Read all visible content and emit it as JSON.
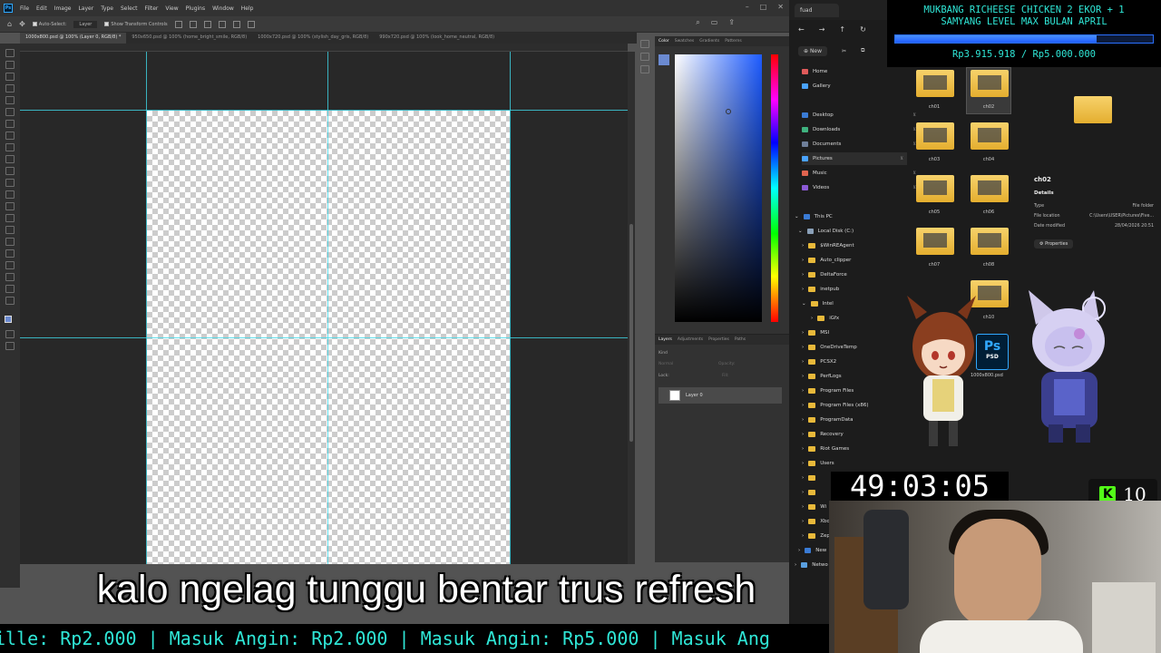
{
  "photoshop": {
    "logo": "Ps",
    "menu": [
      "File",
      "Edit",
      "Image",
      "Layer",
      "Type",
      "Select",
      "Filter",
      "View",
      "Plugins",
      "Window",
      "Help"
    ],
    "options": {
      "auto_select": "Auto-Select:",
      "auto_select_value": "Layer",
      "transform_controls": "Show Transform Controls"
    },
    "doc_tabs": [
      "1000x800.psd @ 100% (Layer 0, RGB/8) *",
      "950x650.psd @ 100% (home_bright_smile, RGB/8)",
      "1000x720.psd @ 100% (stylish_day_gris, RGB/8)",
      "990x720.psd @ 100% (look_home_neutral, RGB/8)"
    ],
    "color_panel_tabs": [
      "Color",
      "Swatches",
      "Gradients",
      "Patterns"
    ],
    "layers_panel_tabs": [
      "Layers",
      "Adjustments",
      "Properties",
      "Paths"
    ],
    "layers": {
      "filter_kind": "Kind",
      "blend_mode": "Normal",
      "opacity_label": "Opacity:",
      "lock_label": "Lock:",
      "fill_label": "Fill:",
      "layer_name": "Layer 0"
    },
    "fg_color": "#6b8ad1"
  },
  "explorer": {
    "tab_title": "fuad",
    "new_button": "New",
    "sidebar": {
      "quick": [
        {
          "label": "Home",
          "color": "#e05a5a"
        },
        {
          "label": "Gallery",
          "color": "#4aa3ff"
        },
        {
          "label": "Desktop",
          "color": "#3a7bd5"
        },
        {
          "label": "Downloads",
          "color": "#3fb27f"
        },
        {
          "label": "Documents",
          "color": "#6f7f99"
        },
        {
          "label": "Pictures",
          "color": "#4aa3ff"
        },
        {
          "label": "Music",
          "color": "#e0644f"
        },
        {
          "label": "Videos",
          "color": "#8c5ad6"
        }
      ],
      "this_pc": "This PC",
      "local_disk": "Local Disk (C:)",
      "folders": [
        "$WinREAgent",
        "Auto_clipper",
        "DeltaForce",
        "inetpub",
        "Intel",
        "iGfx",
        "MSI",
        "OneDriveTemp",
        "PCSX2",
        "PerfLogs",
        "Program Files",
        "Program Files (x86)",
        "ProgramData",
        "Recovery",
        "Riot Games",
        "Users",
        "",
        "",
        "Wi",
        "Xbo",
        "Zep"
      ],
      "network_items": [
        "New",
        "Netwo"
      ]
    },
    "grid_items": [
      "ch01",
      "ch02",
      "ch03",
      "ch04",
      "ch05",
      "ch06",
      "ch07",
      "ch08",
      "",
      "ch10"
    ],
    "details": {
      "name": "ch02",
      "heading": "Details",
      "rows": [
        {
          "k": "Type",
          "v": "File folder"
        },
        {
          "k": "File location",
          "v": "C:\\Users\\USER\\Pictures\\Five..."
        },
        {
          "k": "Date modified",
          "v": "28/04/2026 20:51"
        }
      ],
      "properties": "Properties"
    },
    "psd_file": {
      "icon": "Ps",
      "sub": "PSD",
      "label": "1000x800.psd"
    }
  },
  "overlay": {
    "goal_line1": "MUKBANG RICHEESE CHICKEN 2 EKOR + 1",
    "goal_line2": "SAMYANG LEVEL MAX BULAN APRIL",
    "goal_progress": 0.7832,
    "goal_amount": "Rp3.915.918 / Rp5.000.000",
    "timer": "49:03:05",
    "kick_letter": "K",
    "kick_count": "10",
    "subtitle": "kalo ngelag tunggu bentar trus refresh",
    "ticker": "ille: Rp2.000 | Masuk Angin: Rp2.000 | Masuk Angin: Rp5.000 | Masuk Ang"
  }
}
